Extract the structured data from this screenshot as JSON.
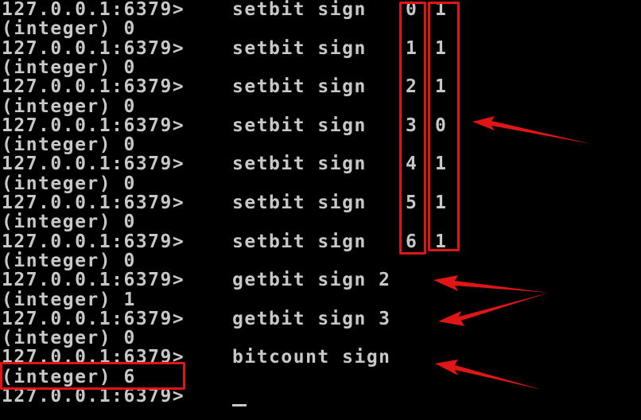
{
  "terminal": {
    "prompt": "127.0.0.1:6379>",
    "lines": [
      {
        "type": "cmd",
        "cmd": "setbit sign",
        "idx": "0",
        "val": "1"
      },
      {
        "type": "out",
        "text": "(integer) 0"
      },
      {
        "type": "cmd",
        "cmd": "setbit sign",
        "idx": "1",
        "val": "1"
      },
      {
        "type": "out",
        "text": "(integer) 0"
      },
      {
        "type": "cmd",
        "cmd": "setbit sign",
        "idx": "2",
        "val": "1"
      },
      {
        "type": "out",
        "text": "(integer) 0"
      },
      {
        "type": "cmd",
        "cmd": "setbit sign",
        "idx": "3",
        "val": "0"
      },
      {
        "type": "out",
        "text": "(integer) 0"
      },
      {
        "type": "cmd",
        "cmd": "setbit sign",
        "idx": "4",
        "val": "1"
      },
      {
        "type": "out",
        "text": "(integer) 0"
      },
      {
        "type": "cmd",
        "cmd": "setbit sign",
        "idx": "5",
        "val": "1"
      },
      {
        "type": "out",
        "text": "(integer) 0"
      },
      {
        "type": "cmd",
        "cmd": "setbit sign",
        "idx": "6",
        "val": "1"
      },
      {
        "type": "out",
        "text": "(integer) 0"
      },
      {
        "type": "cmd",
        "cmd": "getbit sign 2"
      },
      {
        "type": "out",
        "text": "(integer) 1"
      },
      {
        "type": "cmd",
        "cmd": "getbit sign 3"
      },
      {
        "type": "out",
        "text": "(integer) 0"
      },
      {
        "type": "cmd",
        "cmd": "bitcount sign"
      },
      {
        "type": "out",
        "text": "(integer) 6"
      },
      {
        "type": "cmd",
        "cmd": ""
      }
    ]
  },
  "colors": {
    "background": "#000000",
    "text": "#c8c8c8",
    "annotation": "#e01515"
  }
}
